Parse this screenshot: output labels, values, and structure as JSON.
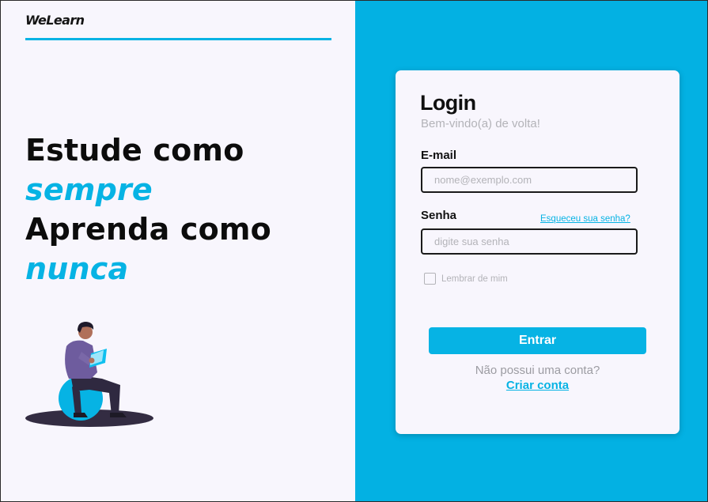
{
  "brand": {
    "logo_text": "WeLearn"
  },
  "hero": {
    "line1": "Estude como",
    "line2": "sempre",
    "line3": "Aprenda como",
    "line4": "nunca"
  },
  "login": {
    "title": "Login",
    "subtitle": "Bem-vindo(a) de volta!",
    "email_label": "E-mail",
    "email_placeholder": "nome@exemplo.com",
    "password_label": "Senha",
    "forgot_link": "Esqueceu sua senha?",
    "password_placeholder": "digite sua senha",
    "remember_label": "Lembrar de mim",
    "remember_checked": false,
    "submit_label": "Entrar",
    "no_account_text": "Não possui uma conta?",
    "create_account_link": "Criar conta"
  },
  "colors": {
    "accent": "#06b3e4",
    "right_panel": "#03b1e3",
    "left_panel": "#f8f6fd",
    "text_dark": "#0c0c0c",
    "muted": "#b3b3b8"
  },
  "icons": {
    "illustration": "person-reading-on-ball-illustration"
  }
}
